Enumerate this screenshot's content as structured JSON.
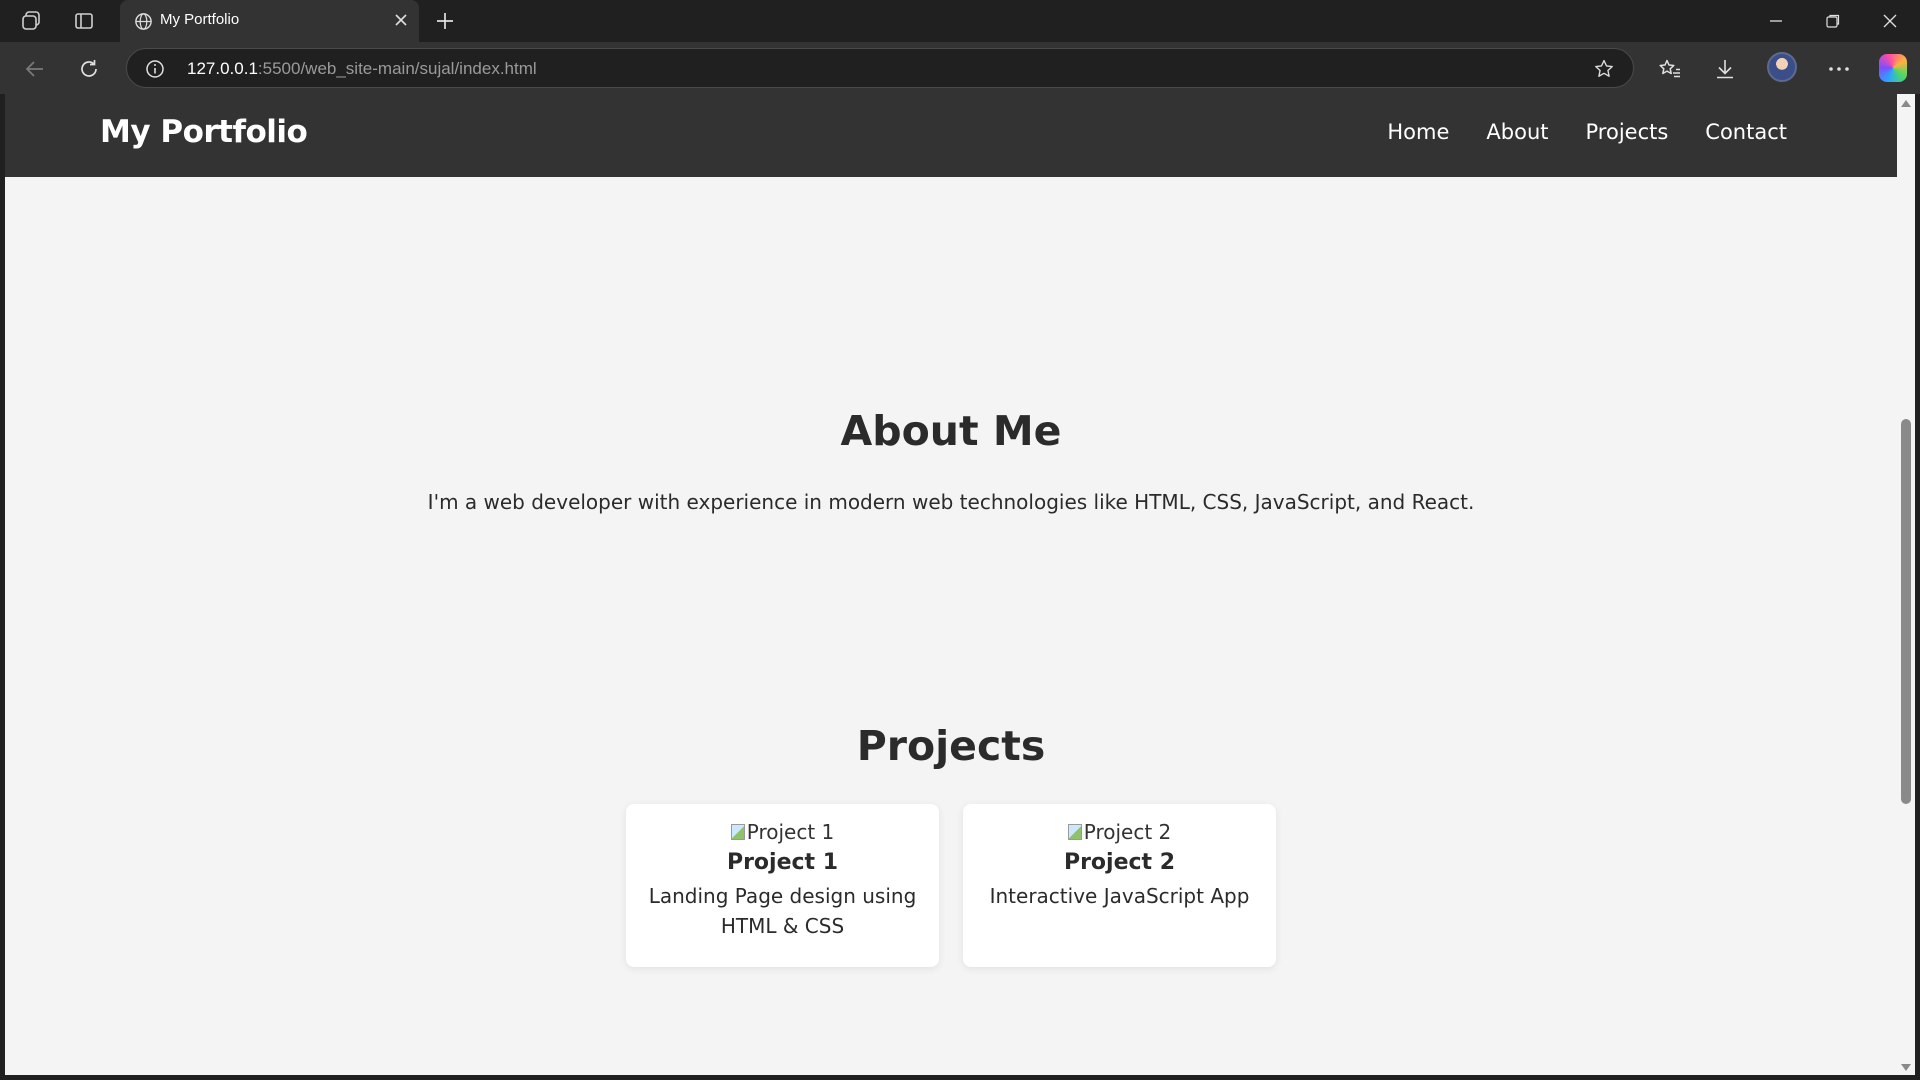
{
  "browser": {
    "tab_title": "My Portfolio",
    "url_host": "127.0.0.1",
    "url_rest": ":5500/web_site-main/sujal/index.html",
    "icons": [
      "workspaces-icon",
      "tab-actions-icon",
      "globe-icon",
      "close-tab-icon",
      "new-tab-icon",
      "minimize-icon",
      "restore-icon",
      "close-window-icon",
      "back-icon",
      "refresh-icon",
      "site-info-icon",
      "favorite-star-icon",
      "favorites-icon",
      "downloads-icon",
      "profile-avatar",
      "more-icon",
      "copilot-icon"
    ]
  },
  "site": {
    "logo": "My Portfolio",
    "nav": [
      "Home",
      "About",
      "Projects",
      "Contact"
    ],
    "about": {
      "title": "About Me",
      "text": "I'm a web developer with experience in modern web technologies like HTML, CSS, JavaScript, and React."
    },
    "projects": {
      "title": "Projects",
      "cards": [
        {
          "img_alt": "Project 1",
          "title": "Project 1",
          "desc": "Landing Page design using HTML & CSS"
        },
        {
          "img_alt": "Project 2",
          "title": "Project 2",
          "desc": "Interactive JavaScript App"
        }
      ]
    }
  },
  "colors": {
    "header_bg": "#333333",
    "page_bg": "#f4f4f4",
    "card_bg": "#ffffff",
    "text": "#2b2b2b",
    "chrome_bg": "#202020"
  }
}
